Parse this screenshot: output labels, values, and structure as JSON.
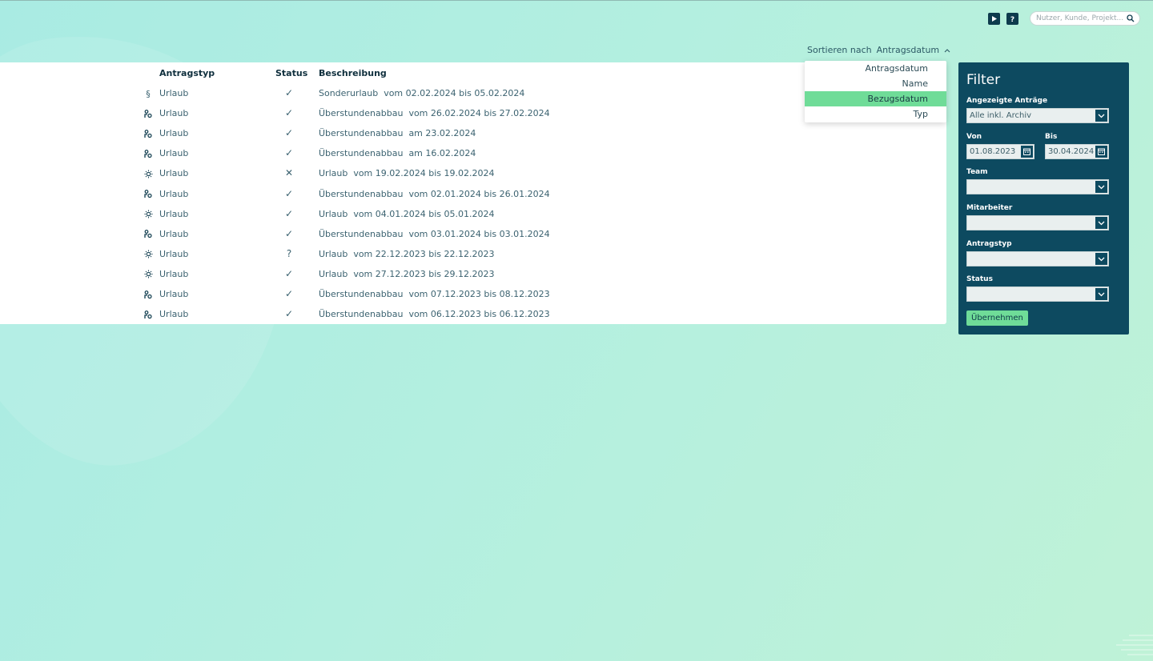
{
  "topbar": {
    "search_placeholder": "Nutzer, Kunde, Projekt..."
  },
  "sort": {
    "label": "Sortieren nach",
    "value": "Antragsdatum",
    "options": [
      "Antragsdatum",
      "Name",
      "Bezugsdatum",
      "Typ"
    ],
    "highlighted": "Bezugsdatum"
  },
  "table": {
    "headers": {
      "type": "Antragstyp",
      "status": "Status",
      "description": "Beschreibung"
    },
    "rows": [
      {
        "icon": "paragraph-icon",
        "type": "Urlaub",
        "status": "✓",
        "description": "Sonderurlaub  vom 02.02.2024 bis 05.02.2024"
      },
      {
        "icon": "overtime-icon",
        "type": "Urlaub",
        "status": "✓",
        "description": "Überstundenabbau  vom 26.02.2024 bis 27.02.2024"
      },
      {
        "icon": "overtime-icon",
        "type": "Urlaub",
        "status": "✓",
        "description": "Überstundenabbau  am 23.02.2024"
      },
      {
        "icon": "overtime-icon",
        "type": "Urlaub",
        "status": "✓",
        "description": "Überstundenabbau  am 16.02.2024"
      },
      {
        "icon": "sun-icon",
        "type": "Urlaub",
        "status": "✕",
        "description": "Urlaub  vom 19.02.2024 bis 19.02.2024"
      },
      {
        "icon": "overtime-icon",
        "type": "Urlaub",
        "status": "✓",
        "description": "Überstundenabbau  vom 02.01.2024 bis 26.01.2024"
      },
      {
        "icon": "sun-icon",
        "type": "Urlaub",
        "status": "✓",
        "description": "Urlaub  vom 04.01.2024 bis 05.01.2024"
      },
      {
        "icon": "overtime-icon",
        "type": "Urlaub",
        "status": "✓",
        "description": "Überstundenabbau  vom 03.01.2024 bis 03.01.2024"
      },
      {
        "icon": "sun-icon",
        "type": "Urlaub",
        "status": "?",
        "description": "Urlaub  vom 22.12.2023 bis 22.12.2023"
      },
      {
        "icon": "sun-icon",
        "type": "Urlaub",
        "status": "✓",
        "description": "Urlaub  vom 27.12.2023 bis 29.12.2023"
      },
      {
        "icon": "overtime-icon",
        "type": "Urlaub",
        "status": "✓",
        "description": "Überstundenabbau  vom 07.12.2023 bis 08.12.2023"
      },
      {
        "icon": "overtime-icon",
        "type": "Urlaub",
        "status": "✓",
        "description": "Überstundenabbau  vom 06.12.2023 bis 06.12.2023"
      }
    ]
  },
  "filter": {
    "title": "Filter",
    "shown_label": "Angezeigte Anträge",
    "shown_value": "Alle inkl. Archiv",
    "from_label": "Von",
    "from_value": "01.08.2023",
    "to_label": "Bis",
    "to_value": "30.04.2024",
    "team_label": "Team",
    "team_value": "",
    "employee_label": "Mitarbeiter",
    "employee_value": "",
    "type_label": "Antragstyp",
    "type_value": "",
    "status_label": "Status",
    "status_value": "",
    "apply_label": "Übernehmen"
  },
  "colors": {
    "accent": "#6fdc98",
    "panel": "#0d4a60",
    "text": "#3b6270"
  }
}
